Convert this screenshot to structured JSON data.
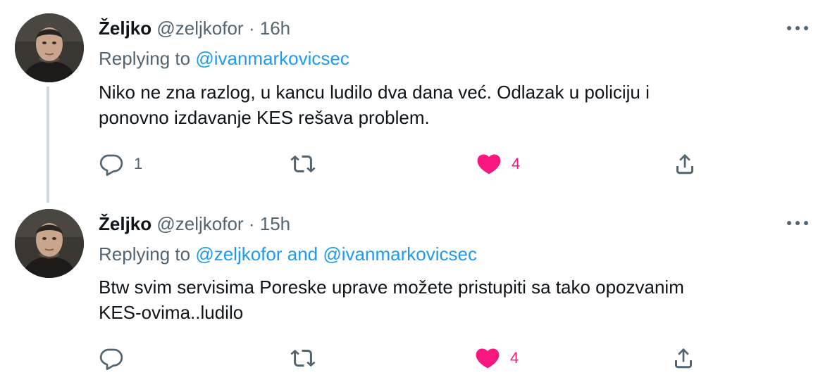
{
  "tweets": [
    {
      "name": "Željko",
      "handle": "@zeljkofor",
      "separator": "·",
      "time": "16h",
      "replying_prefix": "Replying to",
      "replying_users": [
        "@ivanmarkovicsec"
      ],
      "replying_joiner": "",
      "text_lines": [
        "Niko ne zna razlog, u kancu ludilo dva dana već. Odlazak u policiju i",
        "ponovno izdavanje KES rešava problem."
      ],
      "reply_count": "1",
      "retweet_count": "",
      "like_count": "4",
      "liked": true
    },
    {
      "name": "Željko",
      "handle": "@zeljkofor",
      "separator": "·",
      "time": "15h",
      "replying_prefix": "Replying to",
      "replying_users": [
        "@zeljkofor",
        "@ivanmarkovicsec"
      ],
      "replying_joiner": "and",
      "text_lines": [
        "Btw svim servisima Poreske uprave možete pristupiti sa tako opozvanim",
        "KES-ovima..ludilo"
      ],
      "reply_count": "",
      "retweet_count": "",
      "like_count": "4",
      "liked": true
    }
  ],
  "icons": {
    "more": "more-horizontal-icon",
    "reply": "reply-bubble-icon",
    "retweet": "retweet-icon",
    "like": "heart-filled-icon",
    "share": "share-upload-icon"
  },
  "colors": {
    "link": "#1d9bf0",
    "muted": "#536471",
    "like": "#f91880",
    "text": "#0f1419",
    "thread_line": "#cfd9de"
  }
}
